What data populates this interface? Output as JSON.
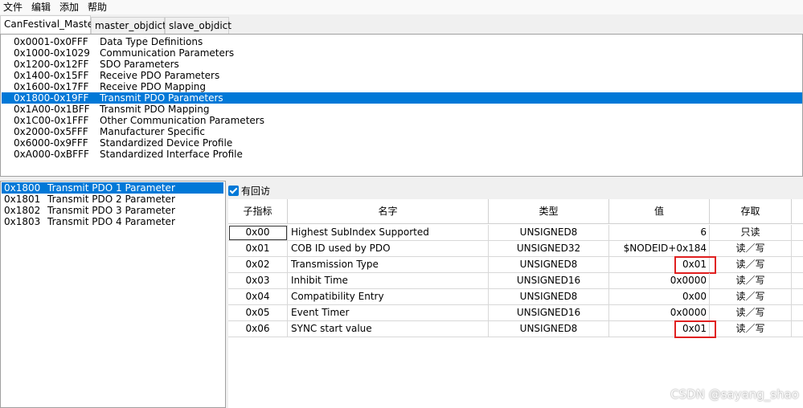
{
  "menu": [
    "文件",
    "编辑",
    "添加",
    "帮助"
  ],
  "tabs": [
    {
      "label": "CanFestival_Master",
      "active": true
    },
    {
      "label": "master_objdict",
      "active": false
    },
    {
      "label": "slave_objdict",
      "active": false
    }
  ],
  "ranges": [
    {
      "code": "0x0001-0x0FFF",
      "label": "Data Type Definitions"
    },
    {
      "code": "0x1000-0x1029",
      "label": "Communication Parameters"
    },
    {
      "code": "0x1200-0x12FF",
      "label": "SDO Parameters"
    },
    {
      "code": "0x1400-0x15FF",
      "label": "Receive PDO Parameters"
    },
    {
      "code": "0x1600-0x17FF",
      "label": "Receive PDO Mapping"
    },
    {
      "code": "0x1800-0x19FF",
      "label": "Transmit PDO Parameters",
      "selected": true
    },
    {
      "code": "0x1A00-0x1BFF",
      "label": "Transmit PDO Mapping"
    },
    {
      "code": "0x1C00-0x1FFF",
      "label": "Other Communication Parameters"
    },
    {
      "code": "0x2000-0x5FFF",
      "label": "Manufacturer Specific"
    },
    {
      "code": "0x6000-0x9FFF",
      "label": "Standardized Device Profile"
    },
    {
      "code": "0xA000-0xBFFF",
      "label": "Standardized Interface Profile"
    }
  ],
  "sub_list": [
    {
      "code": "0x1800",
      "label": "Transmit PDO 1 Parameter",
      "selected": true
    },
    {
      "code": "0x1801",
      "label": "Transmit PDO 2 Parameter"
    },
    {
      "code": "0x1802",
      "label": "Transmit PDO 3 Parameter"
    },
    {
      "code": "0x1803",
      "label": "Transmit PDO 4 Parameter"
    }
  ],
  "callback": {
    "label": "有回访",
    "checked": true
  },
  "grid": {
    "headers": [
      "子指标",
      "名字",
      "类型",
      "值",
      "存取"
    ],
    "rows": [
      {
        "idx": "0x00",
        "name": "Highest SubIndex Supported",
        "type": "UNSIGNED8",
        "value": "6",
        "access": "只读"
      },
      {
        "idx": "0x01",
        "name": "COB ID used by PDO",
        "type": "UNSIGNED32",
        "value": "$NODEID+0x184",
        "access": "读／写"
      },
      {
        "idx": "0x02",
        "name": "Transmission Type",
        "type": "UNSIGNED8",
        "value": "0x01",
        "access": "读／写",
        "highlight": true
      },
      {
        "idx": "0x03",
        "name": "Inhibit Time",
        "type": "UNSIGNED16",
        "value": "0x0000",
        "access": "读／写"
      },
      {
        "idx": "0x04",
        "name": "Compatibility Entry",
        "type": "UNSIGNED8",
        "value": "0x00",
        "access": "读／写"
      },
      {
        "idx": "0x05",
        "name": "Event Timer",
        "type": "UNSIGNED16",
        "value": "0x0000",
        "access": "读／写"
      },
      {
        "idx": "0x06",
        "name": "SYNC start value",
        "type": "UNSIGNED8",
        "value": "0x01",
        "access": "读／写",
        "highlight": true
      }
    ]
  },
  "watermark": "CSDN @sayang_shao",
  "colors": {
    "selection": "#0078d7",
    "highlight_box": "#e02020"
  }
}
